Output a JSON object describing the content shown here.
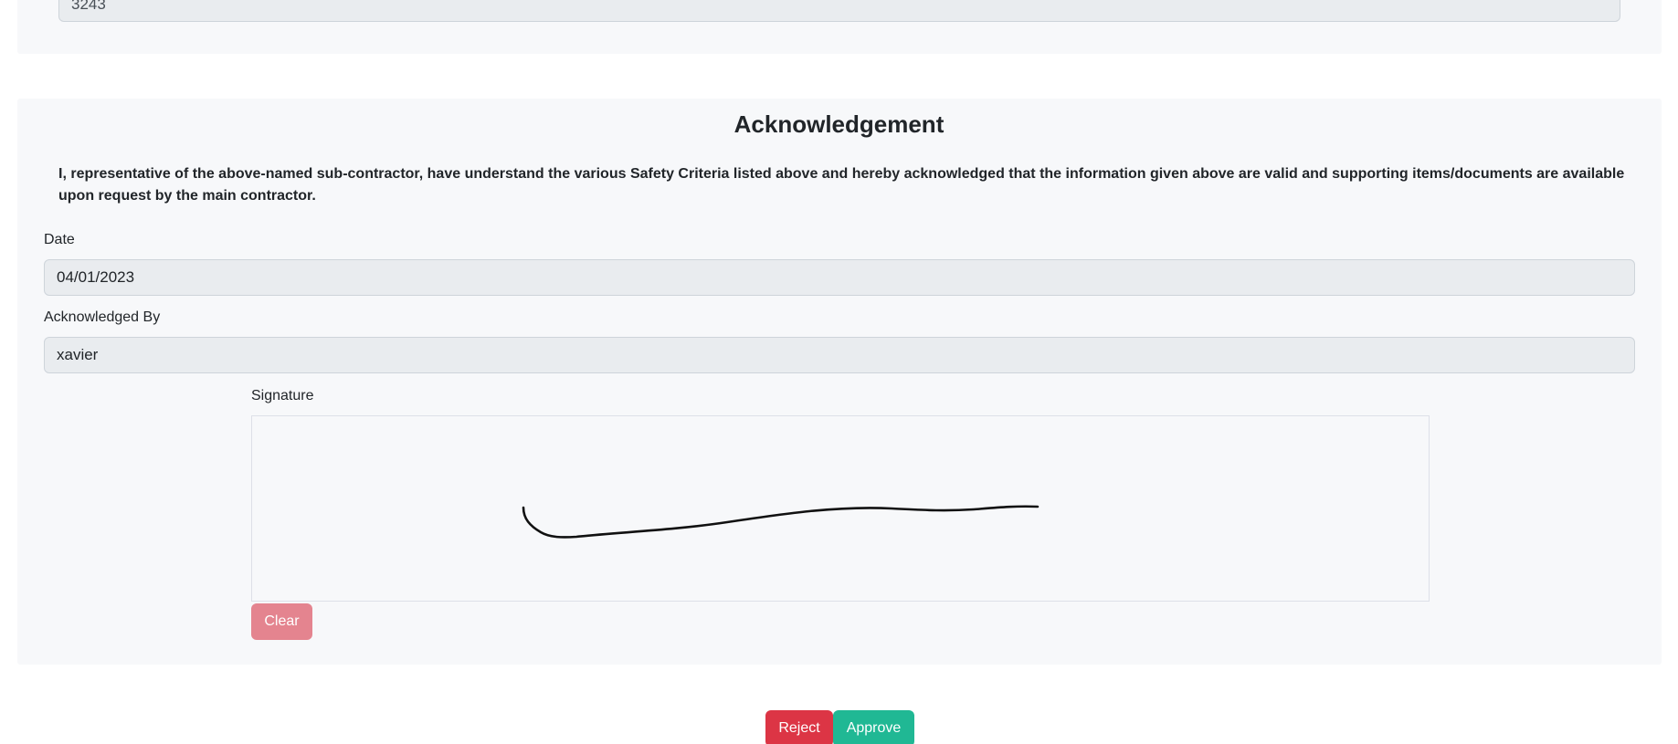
{
  "previous_section": {
    "field_value": "3243"
  },
  "acknowledgement": {
    "title": "Acknowledgement",
    "statement": "I, representative of the above-named sub-contractor, have understand the various Safety Criteria listed above and hereby acknowledged that the information given above are valid and supporting items/documents are available upon request by the main contractor.",
    "date_label": "Date",
    "date_value": "04/01/2023",
    "acknowledged_by_label": "Acknowledged By",
    "acknowledged_by_value": "xavier",
    "signature_label": "Signature",
    "clear_label": "Clear"
  },
  "actions": {
    "reject_label": "Reject",
    "approve_label": "Approve"
  },
  "colors": {
    "card_bg": "#f7f8fa",
    "input_bg": "#e9ecef",
    "reject": "#dc3545",
    "approve": "#20b894",
    "clear": "#e4848f"
  }
}
